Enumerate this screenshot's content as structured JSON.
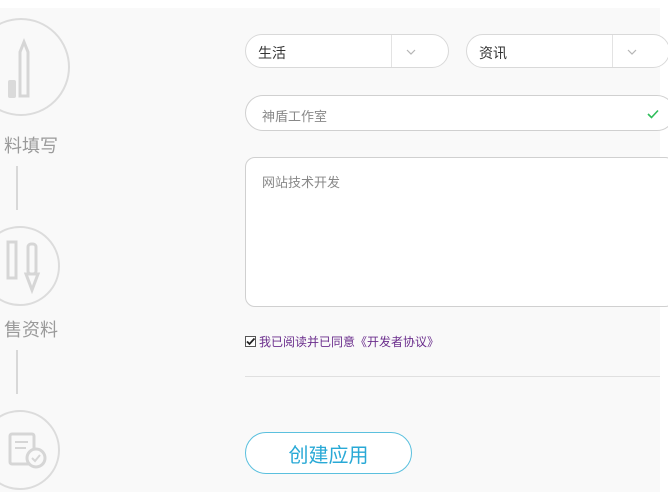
{
  "stepper": {
    "steps": [
      {
        "label": "料填写",
        "icon": "pen-icon"
      },
      {
        "label": "售资料",
        "icon": "tools-icon"
      },
      {
        "label": "",
        "icon": "certificate-icon"
      }
    ]
  },
  "form": {
    "category_primary": {
      "value": "生活"
    },
    "category_secondary": {
      "value": "资讯"
    },
    "company": {
      "value": "神盾工作室",
      "valid": true
    },
    "description": {
      "value": "网站技术开发"
    },
    "agreement": {
      "checked": true,
      "label": "我已阅读并已同意《开发者协议》"
    },
    "submit_label": "创建应用"
  },
  "colors": {
    "accent": "#29a9d6",
    "valid_check": "#2ebd59",
    "agreement_text": "#6a2d8c"
  }
}
